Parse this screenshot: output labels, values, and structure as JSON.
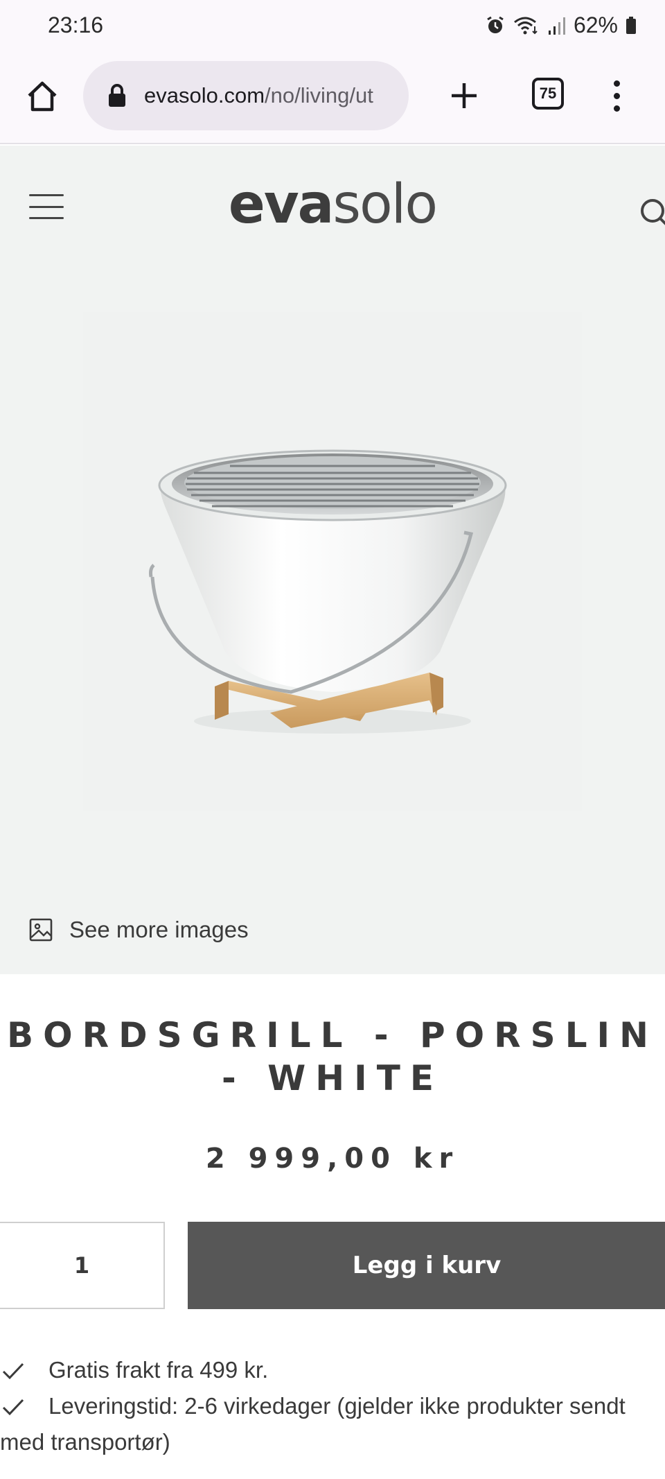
{
  "status": {
    "time": "23:16",
    "battery": "62%",
    "icons": [
      "alarm-icon",
      "wifi-icon",
      "signal-icon",
      "battery-icon"
    ]
  },
  "browser": {
    "url_domain": "evasolo.com",
    "url_path": "/no/living/ut",
    "tab_count": "75"
  },
  "site": {
    "logo_eva": "eva",
    "logo_solo": "solo"
  },
  "hero": {
    "see_more": "See more images"
  },
  "product": {
    "title_line1": "BORDSGRILL - PORSLIN",
    "title_line2": "- WHITE",
    "price": "2 999,00 kr",
    "quantity": "1",
    "add_to_cart": "Legg i kurv"
  },
  "usps": [
    "Gratis frakt fra 499 kr.",
    "Leveringstid: 2-6 virkedager (gjelder ikke produkter sendt med transportør)"
  ],
  "colors": {
    "hero_bg": "#f1f3f2",
    "button_bg": "#575757",
    "text": "#3a3a3a"
  }
}
